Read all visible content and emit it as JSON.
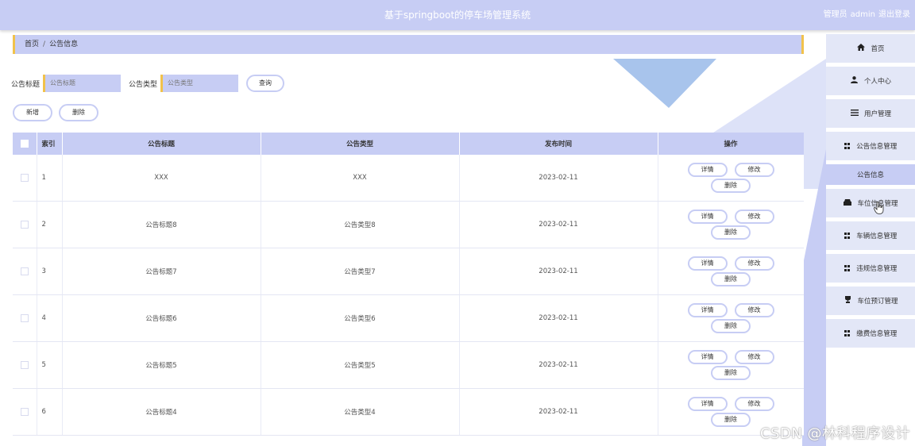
{
  "header": {
    "system_title": "基于springboot的停车场管理系统",
    "user_role": "管理员",
    "username": "admin",
    "logout_label": "退出登录"
  },
  "breadcrumb": {
    "home": "首页",
    "separator": "/",
    "current": "公告信息"
  },
  "search": {
    "title_label": "公告标题",
    "title_placeholder": "公告标题",
    "type_label": "公告类型",
    "type_placeholder": "公告类型",
    "query_label": "查询"
  },
  "actions": {
    "add_label": "新增",
    "delete_label": "删除"
  },
  "table": {
    "columns": {
      "index": "索引",
      "title": "公告标题",
      "type": "公告类型",
      "publish_time": "发布时间",
      "operations": "操作"
    },
    "row_buttons": {
      "detail": "详情",
      "edit": "修改",
      "delete": "删除"
    },
    "rows": [
      {
        "index": "1",
        "title": "XXX",
        "type": "XXX",
        "publish_time": "2023-02-11"
      },
      {
        "index": "2",
        "title": "公告标题8",
        "type": "公告类型8",
        "publish_time": "2023-02-11"
      },
      {
        "index": "3",
        "title": "公告标题7",
        "type": "公告类型7",
        "publish_time": "2023-02-11"
      },
      {
        "index": "4",
        "title": "公告标题6",
        "type": "公告类型6",
        "publish_time": "2023-02-11"
      },
      {
        "index": "5",
        "title": "公告标题5",
        "type": "公告类型5",
        "publish_time": "2023-02-11"
      },
      {
        "index": "6",
        "title": "公告标题4",
        "type": "公告类型4",
        "publish_time": "2023-02-11"
      }
    ]
  },
  "sidebar": {
    "items": [
      {
        "label": "首页",
        "icon": "home-icon"
      },
      {
        "label": "个人中心",
        "icon": "user-icon"
      },
      {
        "label": "用户管理",
        "icon": "menu-icon"
      },
      {
        "label": "公告信息管理",
        "icon": "grid-icon"
      },
      {
        "label": "公告信息",
        "icon": ""
      },
      {
        "label": "车位信息管理",
        "icon": "car-icon"
      },
      {
        "label": "车辆信息管理",
        "icon": "grid-icon"
      },
      {
        "label": "违规信息管理",
        "icon": "grid-icon"
      },
      {
        "label": "车位预订管理",
        "icon": "trophy-icon"
      },
      {
        "label": "缴费信息管理",
        "icon": "grid-icon"
      }
    ]
  },
  "watermark": "CSDN @林科程序设计",
  "colors": {
    "accent": "#c7cdf4",
    "highlight": "#f1c24b",
    "decoration": "#a8c4ec"
  }
}
